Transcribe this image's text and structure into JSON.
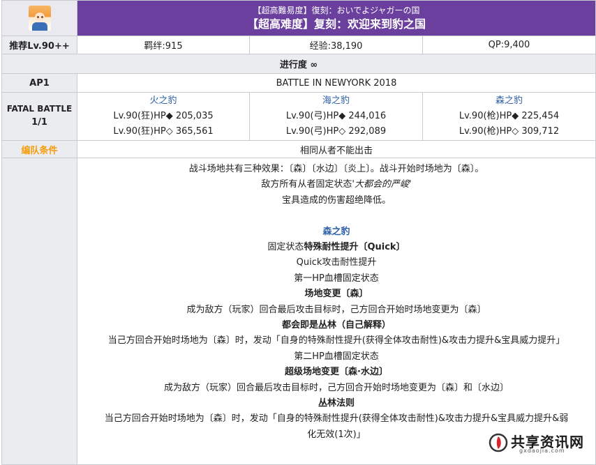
{
  "header": {
    "title_jp": "【超高難易度】復刻：おいでよジャガーの国",
    "title_cn": "【超高难度】复刻：欢迎来到豹之国"
  },
  "stats": {
    "recommend": "推荐Lv.90++",
    "bond": "羁绊:915",
    "exp": "经验:38,190",
    "qp": "QP:9,400"
  },
  "progress": "进行度 ∞",
  "ap": {
    "label": "AP1",
    "battle_name": "BATTLE IN NEWYORK 2018"
  },
  "fatal": {
    "label_line1": "FATAL BATTLE",
    "label_line2": "1/1",
    "enemies": [
      {
        "name": "火之豹",
        "hp1": "Lv.90(狂)HP◆ 205,035",
        "hp2": "Lv.90(狂)HP◇ 365,561"
      },
      {
        "name": "海之豹",
        "hp1": "Lv.90(弓)HP◆ 244,016",
        "hp2": "Lv.90(弓)HP◇ 292,089"
      },
      {
        "name": "森之豹",
        "hp1": "Lv.90(枪)HP◆ 225,454",
        "hp2": "Lv.90(枪)HP◇ 309,712"
      }
    ]
  },
  "formation": {
    "label": "编队条件",
    "value": "相同从者不能出击"
  },
  "description": {
    "l1": "战斗场地共有三种效果：〔森〕〔水边〕〔炎上〕。战斗开始时场地为〔森〕。",
    "l2_prefix": "敌方所有从者固定状态",
    "l2_italic": "'大都会的严峻'",
    "l3": "宝具造成的伤害超绝降低。",
    "forest_title": "森之豹",
    "f1_prefix": "固定状态",
    "f1_bold": "特殊耐性提升〔Quick〕",
    "f2": "Quick攻击耐性提升",
    "f3": "第一HP血槽固定状态",
    "f4": "场地变更〔森〕",
    "f5": "成为敌方（玩家）回合最后攻击目标时，己方回合开始时场地变更为〔森〕",
    "f6": "都会即是丛林（自己解释）",
    "f7": "当己方回合开始时场地为〔森〕时，发动「自身的特殊耐性提升(获得全体攻击耐性)&攻击力提升&宝具威力提升」",
    "f8": "第二HP血槽固定状态",
    "f9": "超级场地变更〔森·水边〕",
    "f10": "成为敌方（玩家）回合最后攻击目标时，己方回合开始时场地变更为〔森〕和〔水边〕",
    "f11": "丛林法则",
    "f12": "当己方回合开始时场地为〔森〕时，发动「自身的特殊耐性提升(获得全体攻击耐性)&攻击力提升&宝具威力提升&弱",
    "f13": "化无效(1次)」"
  },
  "watermark": {
    "text": "共享资讯网",
    "sub": "gxdaojia.com"
  },
  "colors": {
    "header_bg": "#6a3f9e",
    "label_bg": "#eaecf0",
    "link_blue": "#2b5ea7",
    "orange": "#f59d0a"
  }
}
